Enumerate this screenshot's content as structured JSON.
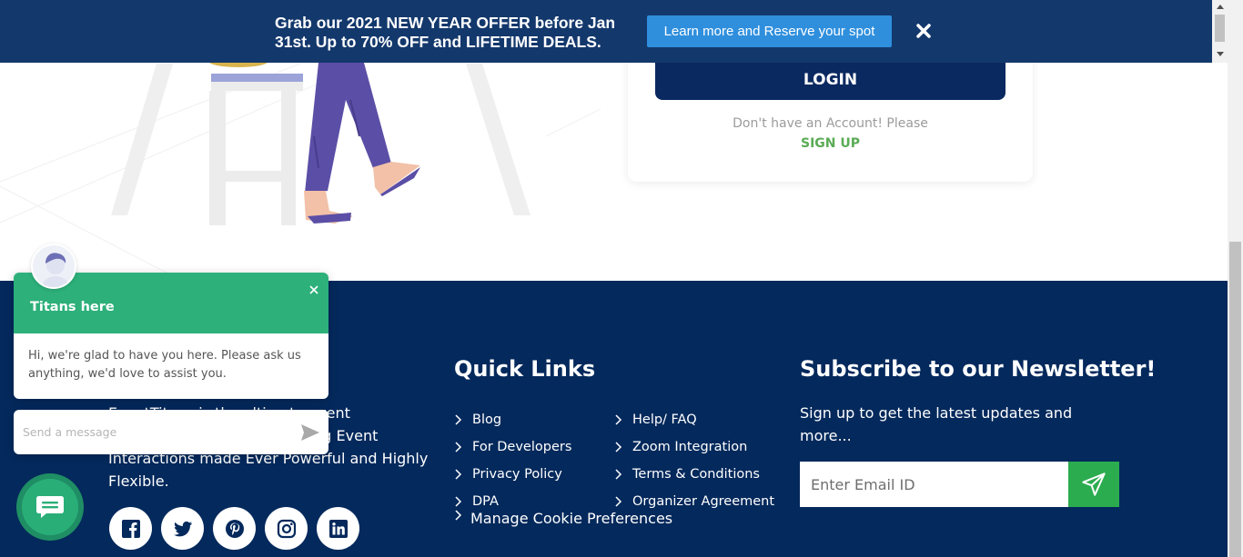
{
  "banner": {
    "offer_text": "Grab our 2021 NEW YEAR OFFER before Jan 31st. Up to 70% OFF and LIFETIME DEALS.",
    "cta_label": "Learn more and Reserve your spot",
    "close_icon": "close-icon",
    "bg_color": "#13386c",
    "cta_color": "#2f8fdd"
  },
  "login": {
    "login_label": "LOGIN",
    "no_account_text": "Don't have an Account! Please",
    "signup_label": "SIGN UP",
    "accent_color": "#0a2960",
    "signup_color": "#5aab55"
  },
  "footer": {
    "bg_color": "#04295c",
    "about_text": "EventTitans is the ultimate event management software making Event Interactions made Ever Powerful and Highly Flexible.",
    "social_icons": [
      "facebook-icon",
      "twitter-icon",
      "pinterest-icon",
      "instagram-icon",
      "linkedin-icon"
    ],
    "quick_links": {
      "title": "Quick Links",
      "col1": [
        "Blog",
        "For Developers",
        "Privacy Policy",
        "DPA"
      ],
      "col2": [
        "Help/ FAQ",
        "Zoom Integration",
        "Terms & Conditions",
        "Organizer Agreement"
      ],
      "cookie_label": "Manage Cookie Preferences"
    },
    "newsletter": {
      "title": "Subscribe to our Newsletter!",
      "subtitle": "Sign up to get the latest updates and more...",
      "placeholder": "Enter Email ID",
      "send_icon": "paper-plane-icon",
      "send_color": "#2bac4f"
    }
  },
  "chat": {
    "agent_name": "Titans here",
    "greeting": "Hi, we're glad to have you here. Please ask us anything, we'd love to assist you.",
    "input_placeholder": "Send a message",
    "header_color": "#2db07a",
    "launcher_icon": "chat-bubble-icon"
  }
}
